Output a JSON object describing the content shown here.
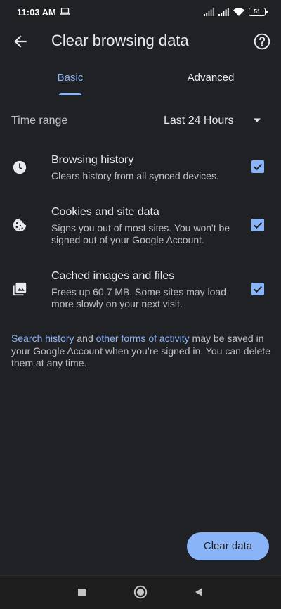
{
  "status_bar": {
    "time": "11:03 AM",
    "battery": "51",
    "icons": [
      "laptop-icon",
      "signal-icon",
      "signal-icon",
      "wifi-icon",
      "battery-icon"
    ]
  },
  "header": {
    "title": "Clear browsing data",
    "back_icon": "arrow-back-icon",
    "help_icon": "help-circle-icon"
  },
  "tabs": [
    {
      "label": "Basic",
      "selected": true
    },
    {
      "label": "Advanced",
      "selected": false
    }
  ],
  "time_range": {
    "label": "Time range",
    "value": "Last 24 Hours"
  },
  "options": [
    {
      "title": "Browsing history",
      "description": "Clears history from all synced devices.",
      "icon": "clock-icon",
      "checked": true
    },
    {
      "title": "Cookies and site data",
      "description": "Signs you out of most sites. You won't be signed out of your Google Account.",
      "icon": "cookie-icon",
      "checked": true
    },
    {
      "title": "Cached images and files",
      "description": "Frees up 60.7 MB. Some sites may load more slowly on your next visit.",
      "icon": "image-icon",
      "checked": true
    }
  ],
  "footer_note": {
    "link1": "Search history",
    "text1": " and ",
    "link2": "other forms of activity",
    "text2": " may be saved in your Google Account when you’re signed in. You can delete them at any time."
  },
  "actions": {
    "clear_data_label": "Clear data"
  },
  "colors": {
    "background": "#202124",
    "accent": "#8ab4f8",
    "text_primary": "#e8eaed",
    "text_secondary": "#bdc1c6"
  }
}
